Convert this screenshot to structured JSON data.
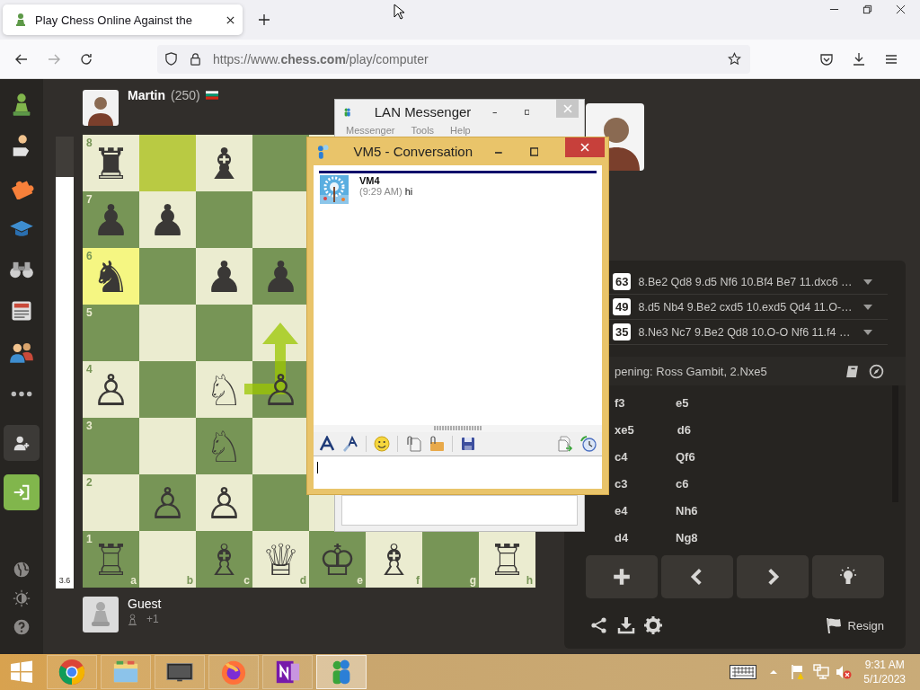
{
  "browser": {
    "tab": {
      "title": "Play Chess Online Against the",
      "selected": true
    },
    "url": "https://www.**chess.com**/play/computer"
  },
  "top_player": {
    "name": "Martin",
    "rating": "(250)"
  },
  "eval_bar": {
    "level": 0.91,
    "reading": "3.6"
  },
  "board": {
    "files": [
      "a",
      "b",
      "c",
      "d",
      "e",
      "f",
      "g",
      "h"
    ],
    "ranks": [
      {
        "label": "8",
        "squares": [
          {
            "glyph": "♜",
            "highlighted": false
          },
          {
            "highlighted": true
          },
          {
            "glyph": "♝",
            "highlighted": false
          },
          {
            "highlighted": false
          }
        ]
      },
      {
        "label": "7",
        "squares": [
          {
            "glyph": "♟",
            "highlighted": false
          },
          {
            "glyph": "♟",
            "highlighted": false
          },
          {
            "highlighted": false
          },
          {
            "highlighted": false
          }
        ]
      },
      {
        "label": "6",
        "squares": [
          {
            "glyph": "♞",
            "highlighted": true
          },
          {
            "highlighted": false
          },
          {
            "glyph": "♟",
            "highlighted": false
          },
          {
            "glyph": "♟",
            "highlighted": false
          }
        ]
      },
      {
        "label": "5",
        "squares": [
          {
            "highlighted": false
          },
          {
            "highlighted": false
          },
          {
            "highlighted": false
          },
          {
            "highlighted": false
          }
        ]
      },
      {
        "label": "4",
        "squares": [
          {
            "glyph": "♙",
            "highlighted": false
          },
          {
            "highlighted": false
          },
          {
            "glyph": "♘",
            "highlighted": false
          },
          {
            "glyph": "♙",
            "highlighted": false
          }
        ]
      },
      {
        "label": "3",
        "squares": [
          {
            "highlighted": false
          },
          {
            "highlighted": false
          },
          {
            "glyph": "♘",
            "highlighted": false
          },
          {
            "highlighted": false
          }
        ]
      },
      {
        "label": "2",
        "squares": [
          {
            "highlighted": false
          },
          {
            "glyph": "♙",
            "highlighted": false
          },
          {
            "glyph": "♙",
            "highlighted": false
          },
          {
            "highlighted": false
          }
        ]
      },
      {
        "label": "1",
        "squares": [
          {
            "glyph": "♖",
            "highlighted": false
          },
          {
            "highlighted": false
          },
          {
            "glyph": "♗",
            "highlighted": false
          },
          {
            "glyph": "♕",
            "highlighted": false
          },
          {
            "glyph": "♔",
            "highlighted": false
          },
          {
            "glyph": "♗",
            "highlighted": false
          },
          {
            "highlighted": false
          },
          {
            "glyph": "♖",
            "highlighted": false
          }
        ]
      }
    ]
  },
  "bottom_player": {
    "name": "Guest",
    "extra": "+1"
  },
  "engine_lines": [
    {
      "score": "63",
      "moves": "8.Be2 Qd8 9.d5 Nf6 10.Bf4 Be7 11.dxc6 …"
    },
    {
      "score": "49",
      "moves": "8.d5 Nb4 9.Be2 cxd5 10.exd5 Qd4 11.O-…"
    },
    {
      "score": "35",
      "moves": "8.Ne3 Nc7 9.Be2 Qd8 10.O-O Nf6 11.f4 …"
    }
  ],
  "opening": "pening: Ross Gambit, 2.Nxe5",
  "moves": [
    {
      "white": "f3",
      "black": "e5"
    },
    {
      "white": "xe5",
      "black": "d6"
    },
    {
      "white": "c4",
      "black": "Qf6"
    },
    {
      "white": "c3",
      "black": "c6"
    },
    {
      "white": "e4",
      "black": "Nh6"
    },
    {
      "white": "d4",
      "black": "Ng8"
    }
  ],
  "resign": "Resign",
  "lan_messenger": {
    "title": "LAN Messenger",
    "menu": [
      "Messenger",
      "Tools",
      "Help"
    ]
  },
  "conversation": {
    "title": "VM5 - Conversation",
    "messages": [
      {
        "sender": "VM4",
        "time": "(9:29 AM)",
        "text": "hi"
      }
    ]
  },
  "taskbar": {
    "apps": [
      {
        "kind": "chrome",
        "selected": false
      },
      {
        "kind": "explorer",
        "selected": false
      },
      {
        "kind": "desktop",
        "selected": false
      },
      {
        "kind": "firefox",
        "selected": false
      },
      {
        "kind": "onenote",
        "selected": false
      },
      {
        "kind": "messenger",
        "selected": true
      }
    ],
    "time": "9:31 AM",
    "date": "5/1/2023"
  }
}
